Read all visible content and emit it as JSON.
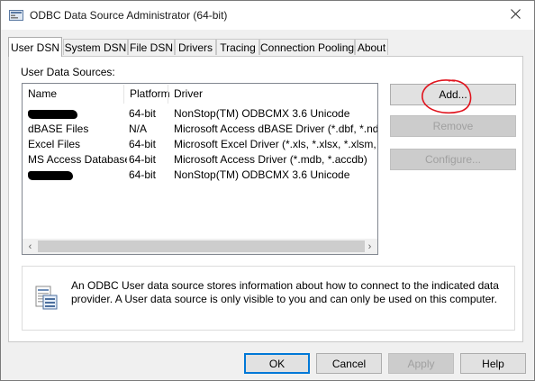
{
  "window": {
    "title": "ODBC Data Source Administrator (64-bit)"
  },
  "tabs": [
    {
      "label": "User DSN",
      "active": true
    },
    {
      "label": "System DSN",
      "active": false
    },
    {
      "label": "File DSN",
      "active": false
    },
    {
      "label": "Drivers",
      "active": false
    },
    {
      "label": "Tracing",
      "active": false
    },
    {
      "label": "Connection Pooling",
      "active": false
    },
    {
      "label": "About",
      "active": false
    }
  ],
  "user_dsn": {
    "section_label": "User Data Sources:",
    "columns": [
      "Name",
      "Platform",
      "Driver"
    ],
    "rows": [
      {
        "name": "",
        "redacted": true,
        "platform": "64-bit",
        "driver": "NonStop(TM) ODBCMX 3.6 Unicode"
      },
      {
        "name": "dBASE Files",
        "redacted": false,
        "platform": "N/A",
        "driver": "Microsoft Access dBASE Driver (*.dbf, *.ndx, *.m"
      },
      {
        "name": "Excel Files",
        "redacted": false,
        "platform": "64-bit",
        "driver": "Microsoft Excel Driver (*.xls, *.xlsx, *.xlsm, *.xlsb)"
      },
      {
        "name": "MS Access Database",
        "redacted": false,
        "platform": "64-bit",
        "driver": "Microsoft Access Driver (*.mdb, *.accdb)"
      },
      {
        "name": "",
        "redacted": true,
        "platform": "64-bit",
        "driver": "NonStop(TM) ODBCMX 3.6 Unicode"
      }
    ],
    "buttons": {
      "add": "Add...",
      "remove": "Remove",
      "configure": "Configure..."
    },
    "info_text": "An ODBC User data source stores information about how to connect to the indicated data provider.   A User data source is only visible to you and can only be used on this computer."
  },
  "footer": {
    "ok": "OK",
    "cancel": "Cancel",
    "apply": "Apply",
    "help": "Help"
  },
  "colors": {
    "annotation": "#e0141e",
    "focus_border": "#0078d7"
  }
}
